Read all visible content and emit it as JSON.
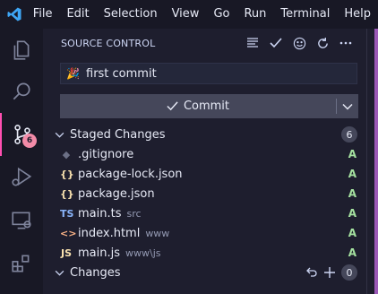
{
  "menubar": {
    "logo_icon": "vscode-logo-icon",
    "items": [
      "File",
      "Edit",
      "Selection",
      "View",
      "Go",
      "Run",
      "Terminal",
      "Help"
    ]
  },
  "activity_bar": {
    "items": [
      {
        "name": "explorer-icon"
      },
      {
        "name": "search-icon"
      },
      {
        "name": "source-control-icon",
        "badge": "6",
        "active": true
      },
      {
        "name": "run-debug-icon"
      },
      {
        "name": "remote-explorer-icon"
      },
      {
        "name": "extensions-icon"
      }
    ]
  },
  "panel": {
    "title": "SOURCE CONTROL",
    "header_actions": [
      "view-as-list-icon",
      "check-icon",
      "smiley-icon",
      "refresh-icon",
      "more-icon"
    ],
    "commit_message": {
      "emoji": "🎉",
      "text": "first commit"
    },
    "commit_button": {
      "label": "Commit"
    },
    "staged": {
      "label": "Staged Changes",
      "count": "6",
      "files": [
        {
          "icon": "◆",
          "icon_color": "#6c7086",
          "name": ".gitignore",
          "dir": "",
          "status": "A"
        },
        {
          "icon": "{}",
          "icon_color": "#f9e2af",
          "name": "package-lock.json",
          "dir": "",
          "status": "A"
        },
        {
          "icon": "{}",
          "icon_color": "#f9e2af",
          "name": "package.json",
          "dir": "",
          "status": "A"
        },
        {
          "icon": "TS",
          "icon_color": "#89b4fa",
          "name": "main.ts",
          "dir": "src",
          "status": "A"
        },
        {
          "icon": "<>",
          "icon_color": "#fab387",
          "name": "index.html",
          "dir": "www",
          "status": "A"
        },
        {
          "icon": "JS",
          "icon_color": "#f9e2af",
          "name": "main.js",
          "dir": "www\\js",
          "status": "A"
        }
      ]
    },
    "changes": {
      "label": "Changes",
      "count": "0"
    }
  },
  "colors": {
    "accent": "#ff4fb1",
    "badge": "#f38ba8",
    "added": "#a6e3a1"
  }
}
